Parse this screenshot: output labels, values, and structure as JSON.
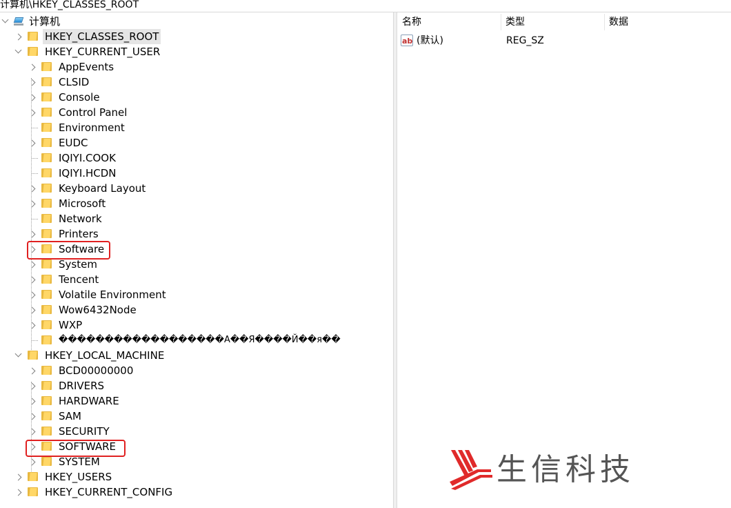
{
  "address_bar": {
    "path": "计算机\\HKEY_CLASSES_ROOT"
  },
  "tree": {
    "root": {
      "label": "计算机",
      "icon": "computer-icon"
    },
    "hives": [
      {
        "label": "HKEY_CLASSES_ROOT",
        "expanded": false,
        "selected": true
      },
      {
        "label": "HKEY_CURRENT_USER",
        "expanded": true,
        "children": [
          "AppEvents",
          "CLSID",
          "Console",
          "Control Panel",
          "Environment",
          "EUDC",
          "IQIYI.COOK",
          "IQIYI.HCDN",
          "Keyboard Layout",
          "Microsoft",
          "Network",
          "Printers",
          "Software",
          "System",
          "Tencent",
          "Volatile Environment",
          "Wow6432Node",
          "WXP",
          "������������������A��Я����Й��я��"
        ]
      },
      {
        "label": "HKEY_LOCAL_MACHINE",
        "expanded": true,
        "children": [
          "BCD00000000",
          "DRIVERS",
          "HARDWARE",
          "SAM",
          "SECURITY",
          "SOFTWARE",
          "SYSTEM"
        ]
      },
      {
        "label": "HKEY_USERS",
        "expanded": false
      },
      {
        "label": "HKEY_CURRENT_CONFIG",
        "expanded": false
      }
    ]
  },
  "list": {
    "columns": [
      "名称",
      "类型",
      "数据"
    ],
    "rows": [
      {
        "name": "(默认)",
        "type": "REG_SZ",
        "data": ""
      }
    ]
  },
  "watermark": {
    "text": "生信科技"
  },
  "colors": {
    "highlight": "#e02020",
    "selected_bg": "#e5e5e5",
    "folder": "#ffd767"
  }
}
